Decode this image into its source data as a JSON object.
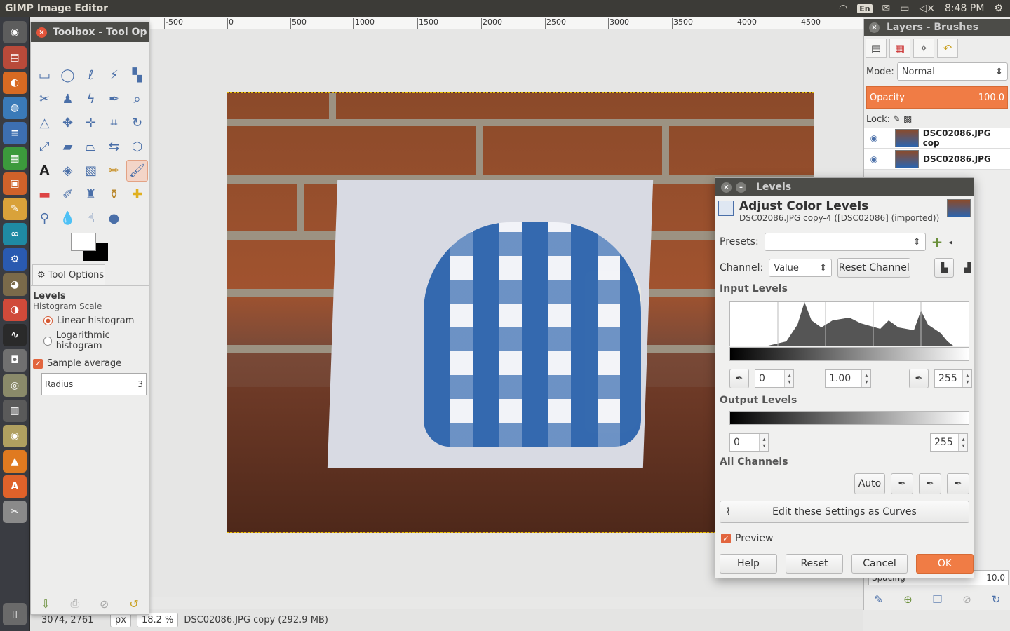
{
  "topbar": {
    "app_title": "GIMP Image Editor",
    "keyboard": "En",
    "time": "8:48 PM"
  },
  "ruler": {
    "ticks": [
      "-500",
      "0",
      "500",
      "1000",
      "1500",
      "2000",
      "2500",
      "3000",
      "3500",
      "4000",
      "4500"
    ]
  },
  "statusbar": {
    "coords": "3074, 2761",
    "unit": "px",
    "zoom": "18.2 %",
    "info": "DSC02086.JPG copy (292.9 MB)"
  },
  "toolbox": {
    "title": "Toolbox - Tool Op",
    "tab_label": "Tool Options",
    "section_title": "Levels",
    "histogram_scale_label": "Histogram Scale",
    "linear_label": "Linear histogram",
    "log_label": "Logarithmic histogram",
    "sample_average_label": "Sample average",
    "radius_label": "Radius",
    "radius_value": "3"
  },
  "dock": {
    "title": "Layers - Brushes",
    "mode_label": "Mode:",
    "mode_value": "Normal",
    "opacity_label": "Opacity",
    "opacity_value": "100.0",
    "lock_label": "Lock:",
    "layers": [
      {
        "name": "DSC02086.JPG cop"
      },
      {
        "name": "DSC02086.JPG"
      }
    ],
    "spacing_label": "Spacing",
    "spacing_value": "10.0"
  },
  "levels": {
    "window_title": "Levels",
    "heading": "Adjust Color Levels",
    "subheading": "DSC02086.JPG copy-4 ([DSC02086] (imported))",
    "presets_label": "Presets:",
    "presets_value": "",
    "channel_label": "Channel:",
    "channel_value": "Value",
    "reset_channel_label": "Reset Channel",
    "input_levels_label": "Input Levels",
    "input_low": "0",
    "input_gamma": "1.00",
    "input_high": "255",
    "output_levels_label": "Output Levels",
    "output_low": "0",
    "output_high": "255",
    "all_channels_label": "All Channels",
    "auto_label": "Auto",
    "edit_curves_label": "Edit these Settings as Curves",
    "preview_label": "Preview",
    "help_label": "Help",
    "reset_label": "Reset",
    "cancel_label": "Cancel",
    "ok_label": "OK"
  },
  "colors": {
    "accent": "#f07c45",
    "titlebar": "#4c4c48",
    "panel": "#3c3b37"
  }
}
